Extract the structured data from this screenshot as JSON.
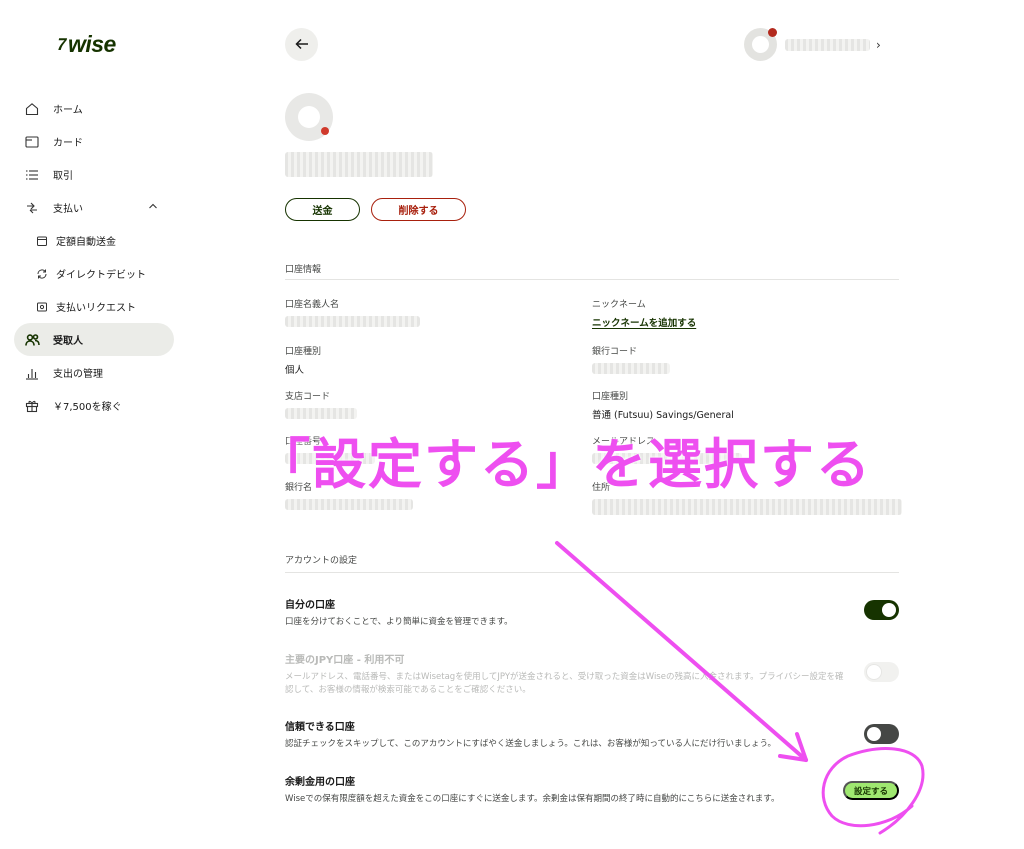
{
  "brand": {
    "logo_text": "wise",
    "logo_mark": "7"
  },
  "sidebar": {
    "items": [
      {
        "label": "ホーム",
        "icon": "home-icon"
      },
      {
        "label": "カード",
        "icon": "card-icon"
      },
      {
        "label": "取引",
        "icon": "list-icon"
      },
      {
        "label": "支払い",
        "icon": "transfer-icon"
      },
      {
        "label": "定額自動送金",
        "icon": "calendar-icon"
      },
      {
        "label": "ダイレクトデビット",
        "icon": "refresh-icon"
      },
      {
        "label": "支払いリクエスト",
        "icon": "request-icon"
      },
      {
        "label": "受取人",
        "icon": "people-icon"
      },
      {
        "label": "支出の管理",
        "icon": "chart-icon"
      },
      {
        "label": "￥7,500を稼ぐ",
        "icon": "gift-icon"
      }
    ],
    "active_item": "受取人"
  },
  "recipient": {
    "send_label": "送金",
    "delete_label": "削除する"
  },
  "details": {
    "section_title": "口座情報",
    "fields": [
      {
        "label": "口座名義人名",
        "value": ""
      },
      {
        "label": "ニックネーム",
        "link": "ニックネームを追加する"
      },
      {
        "label": "口座種別",
        "value": "個人"
      },
      {
        "label": "銀行コード",
        "value": ""
      },
      {
        "label": "支店コード",
        "value": ""
      },
      {
        "label": "口座種別",
        "value": "普通 (Futsuu) Savings/General"
      },
      {
        "label": "口座番号",
        "value": ""
      },
      {
        "label": "メールアドレス",
        "value": ""
      },
      {
        "label": "銀行名",
        "value": ""
      },
      {
        "label": "住所",
        "value": ""
      }
    ]
  },
  "settings": {
    "section_title": "アカウントの設定",
    "items": [
      {
        "title": "自分の口座",
        "desc": "口座を分けておくことで、より簡単に資金を管理できます。",
        "state": "on"
      },
      {
        "title": "主要のJPY口座 - 利用不可",
        "desc": "メールアドレス、電話番号、またはWisetagを使用してJPYが送金されると、受け取った資金はWiseの残高に入金されます。プライバシー設定を確認して、お客様の情報が検索可能であることをご確認ください。",
        "state": "disabled"
      },
      {
        "title": "信頼できる口座",
        "desc": "認証チェックをスキップして、このアカウントにすばやく送金しましょう。これは、お客様が知っている人にだけ行いましょう。",
        "state": "off"
      },
      {
        "title": "余剰金用の口座",
        "desc": "Wiseでの保有限度額を超えた資金をこの口座にすぐに送金します。余剰金は保有期間の終了時に自動的にこちらに送金されます。",
        "action_label": "設定する"
      }
    ]
  },
  "annotation": {
    "text": "「設定する」を選択する",
    "color": "#ee4ff0"
  },
  "colors": {
    "brand_green": "#163300",
    "accent_lime": "#9fe870",
    "danger": "#a8200d"
  }
}
